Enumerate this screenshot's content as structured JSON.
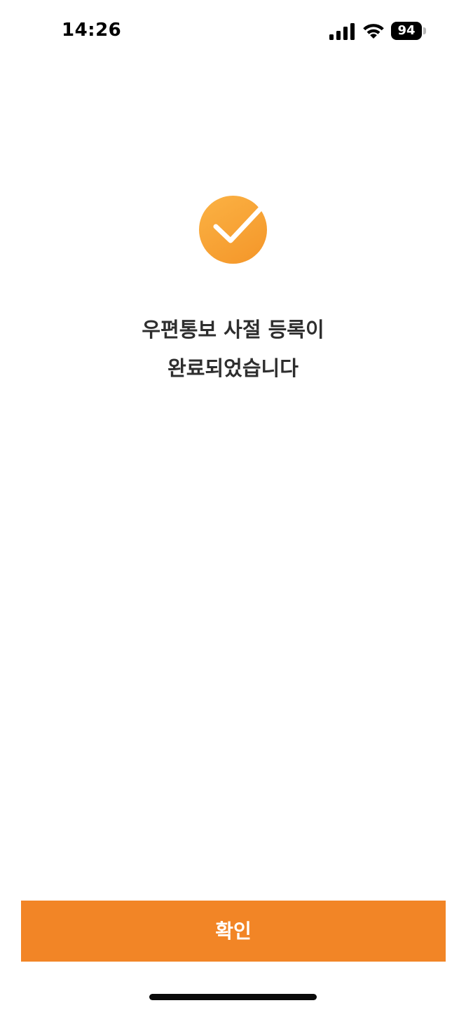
{
  "status_bar": {
    "time": "14:26",
    "battery": "94",
    "icons": [
      "signal-icon",
      "wifi-icon",
      "battery-icon"
    ]
  },
  "result": {
    "icon": "check-circle-icon",
    "message_line1": "우편통보 사절 등록이",
    "message_line2": "완료되었습니다"
  },
  "confirm_button": {
    "label": "확인"
  },
  "colors": {
    "accent": "#F28526",
    "check_gradient_start": "#FBB244",
    "check_gradient_end": "#F59A2D",
    "text": "#2E2E2E",
    "background": "#FFFFFF"
  }
}
